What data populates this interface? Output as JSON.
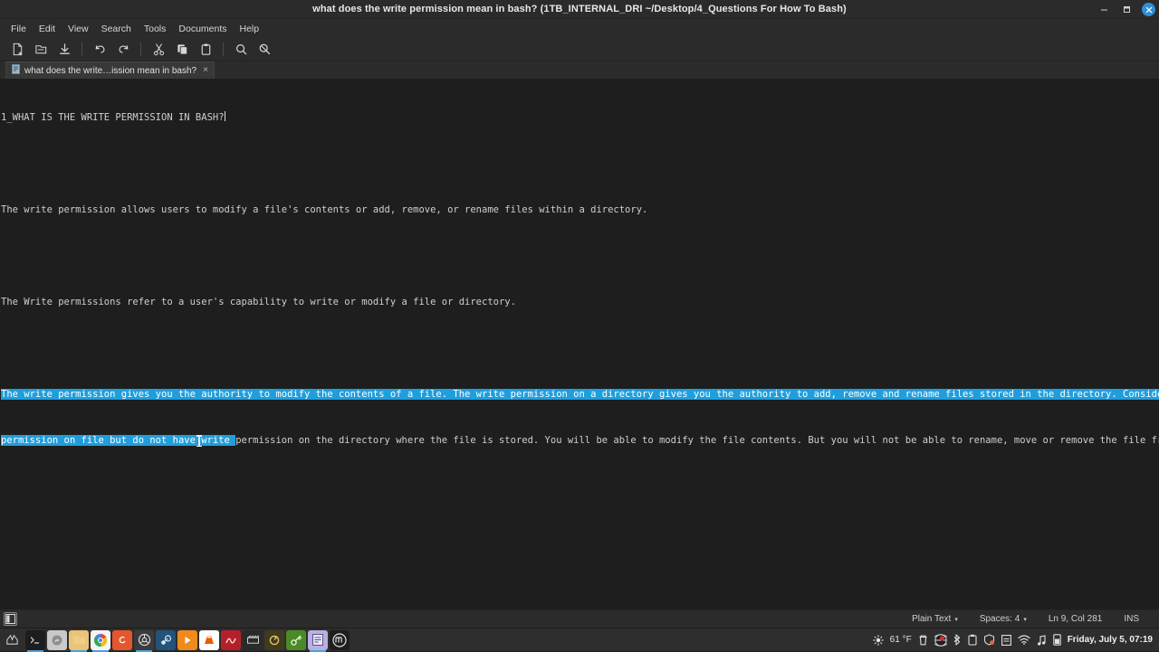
{
  "window": {
    "title": "what does the write permission mean in bash? (1TB_INTERNAL_DRI ~/Desktop/4_Questions For How To Bash)",
    "controls": {
      "minimize": "minimize-button",
      "maximize": "maximize-button",
      "close": "close-button"
    }
  },
  "menubar": {
    "items": [
      {
        "label": "File"
      },
      {
        "label": "Edit"
      },
      {
        "label": "View"
      },
      {
        "label": "Search"
      },
      {
        "label": "Tools"
      },
      {
        "label": "Documents"
      },
      {
        "label": "Help"
      }
    ]
  },
  "toolbar": {
    "buttons": [
      {
        "name": "new-file-icon",
        "title": "New"
      },
      {
        "name": "open-file-icon",
        "title": "Open"
      },
      {
        "name": "save-file-icon",
        "title": "Save"
      },
      {
        "name": "undo-icon",
        "title": "Undo"
      },
      {
        "name": "redo-icon",
        "title": "Redo"
      },
      {
        "name": "cut-icon",
        "title": "Cut"
      },
      {
        "name": "copy-icon",
        "title": "Copy"
      },
      {
        "name": "paste-icon",
        "title": "Paste"
      },
      {
        "name": "find-icon",
        "title": "Find"
      },
      {
        "name": "find-replace-icon",
        "title": "Find and Replace"
      }
    ]
  },
  "tabs": [
    {
      "label": "what does the write…ission mean in bash?",
      "close": "×",
      "active": true
    }
  ],
  "document": {
    "lines": [
      {
        "id": 1,
        "text": "1_WHAT IS THE WRITE PERMISSION IN BASH?",
        "selected": false
      },
      {
        "id": 2,
        "text": "",
        "selected": false
      },
      {
        "id": 3,
        "text": "The write permission allows users to modify a file's contents or add, remove, or rename files within a directory.",
        "selected": false
      },
      {
        "id": 4,
        "text": "",
        "selected": false
      },
      {
        "id": 5,
        "text": "The Write permissions refer to a user's capability to write or modify a file or directory.",
        "selected": false
      },
      {
        "id": 6,
        "text": "",
        "selected": false
      }
    ],
    "wrapped_paragraph": {
      "selected_text": "The write permission gives you the authority to modify the contents of a file. The write permission on a directory gives you the authority to add, remove and rename files stored in the directory. Consider a scenario where you have to write permission on file but do not have write ",
      "unselected_text": "permission on the directory where the file is stored. You will be able to modify the file contents. But you will not be able to rename, move or remove the file from the directory.",
      "row1_selected": "The write permission gives you the authority to modify the contents of a file. The write permission on a directory gives you the authority to add, remove and rename files stored in the directory. Consider a scenario where you have to write",
      "row2_selected": "permission on file but do not have write ",
      "row2_plain": "permission on the directory where the file is stored. You will be able to modify the file contents. But you will not be able to rename, move or remove the file from the directory."
    }
  },
  "statusbar": {
    "sidebar_toggle": "sidebar-toggle-icon",
    "language": "Plain Text",
    "indent": "Spaces: 4",
    "position": "Ln 9, Col 281",
    "insert_mode": "INS",
    "dropdown_caret": "▾"
  },
  "taskbar": {
    "menu_icon": "mint-menu-icon",
    "launchers": [
      {
        "name": "terminal",
        "glyph": "▸_",
        "bg": "#1d1d1d",
        "fg": "#d8d8d8",
        "running": false
      },
      {
        "name": "app-gray",
        "glyph": "●",
        "bg": "#c9c9c9",
        "fg": "#555555",
        "running": false
      },
      {
        "name": "file-manager",
        "glyph": "",
        "bg": "#e8c37a",
        "fg": "#8a6a22",
        "running": true
      },
      {
        "name": "google-chrome",
        "glyph": "",
        "bg": "#f2f2f2",
        "fg": "#4285f4",
        "running": true
      },
      {
        "name": "firefox",
        "glyph": "",
        "bg": "#e4572e",
        "fg": "#ffffff",
        "running": false
      },
      {
        "name": "media-app",
        "glyph": "◎",
        "bg": "#3b3b3b",
        "fg": "#e0e0e0",
        "running": true
      },
      {
        "name": "steam",
        "glyph": "",
        "bg": "#23527a",
        "fg": "#cfe3f0",
        "running": false
      },
      {
        "name": "video-player",
        "glyph": "▶",
        "bg": "#f08a1d",
        "fg": "#ffffff",
        "running": false
      },
      {
        "name": "vlc",
        "glyph": "",
        "bg": "#ffffff",
        "fg": "#e85d04",
        "running": false
      },
      {
        "name": "audacity",
        "glyph": "",
        "bg": "#b4202a",
        "fg": "#ffffff",
        "running": false
      },
      {
        "name": "clapperboard",
        "glyph": "›››",
        "bg": "#2a2a2a",
        "fg": "#d0d0d0",
        "running": false
      },
      {
        "name": "update-manager",
        "glyph": "↻",
        "bg": "#3f3a20",
        "fg": "#e0c060",
        "running": false
      },
      {
        "name": "key-tool",
        "glyph": "⚷",
        "bg": "#4a8a28",
        "fg": "#d9f2b0",
        "running": false
      },
      {
        "name": "text-editor",
        "glyph": "",
        "bg": "#b8b0e0",
        "fg": "#3a3560",
        "running": true
      },
      {
        "name": "linux-mint",
        "glyph": "",
        "bg": "#1e1e1e",
        "fg": "#e0e0e0",
        "running": false
      }
    ],
    "tray": {
      "weather_icon": "sun-icon",
      "temperature": "61 °F",
      "icons": [
        {
          "name": "trash-icon"
        },
        {
          "name": "globe-icon"
        },
        {
          "name": "bluetooth-icon"
        },
        {
          "name": "clipboard-icon"
        },
        {
          "name": "shield-icon"
        },
        {
          "name": "notes-icon"
        },
        {
          "name": "wifi-icon"
        },
        {
          "name": "music-note-icon"
        },
        {
          "name": "battery-icon"
        }
      ],
      "clock": "Friday, July 5, 07:19"
    }
  },
  "colors": {
    "selection": "#1f9ede",
    "chrome": "#2b2b2b",
    "editor_bg": "#1e1e1e",
    "accent": "#2d8fd5"
  }
}
